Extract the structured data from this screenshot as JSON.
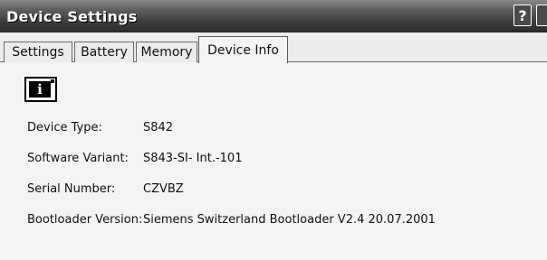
{
  "window": {
    "title": "Device Settings",
    "help_label": "?"
  },
  "tabs": [
    {
      "label": "Settings"
    },
    {
      "label": "Battery"
    },
    {
      "label": "Memory"
    },
    {
      "label": "Device Info",
      "active": true
    }
  ],
  "device_info": {
    "icon": "info-icon",
    "fields": [
      {
        "label": "Device Type:",
        "value": "S842"
      },
      {
        "label": "Software Variant:",
        "value": "S843-SI- Int.-101"
      },
      {
        "label": "Serial Number:",
        "value": "CZVBZ"
      },
      {
        "label": "Bootloader Version:",
        "value": "Siemens Switzerland Bootloader V2.4 20.07.2001"
      }
    ]
  }
}
